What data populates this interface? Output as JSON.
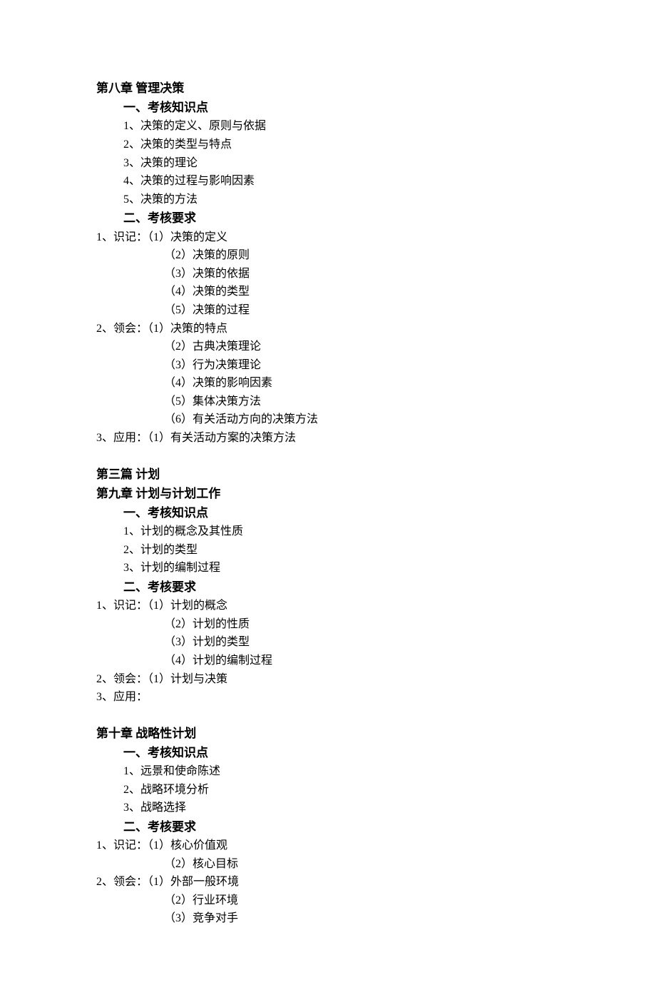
{
  "ch8": {
    "title": "第八章 管理决策",
    "s1": {
      "heading": "一、考核知识点",
      "p1": "1、决策的定义、原则与依据",
      "p2": "2、决策的类型与特点",
      "p3": "3、决策的理论",
      "p4": "4、决策的过程与影响因素",
      "p5": "5、决策的方法"
    },
    "s2": {
      "heading": "二、考核要求",
      "r1": "1、识记：（1）决策的定义",
      "r1a": "（2）决策的原则",
      "r1b": "（3）决策的依据",
      "r1c": "（4）决策的类型",
      "r1d": "（5）决策的过程",
      "r2": "2、领会：（1）决策的特点",
      "r2a": "（2）古典决策理论",
      "r2b": "（3）行为决策理论",
      "r2c": "（4）决策的影响因素",
      "r2d": "（5）集体决策方法",
      "r2e": "（6）有关活动方向的决策方法",
      "r3": "3、应用：（1）有关活动方案的决策方法"
    }
  },
  "part3": {
    "title": "第三篇 计划"
  },
  "ch9": {
    "title": "第九章 计划与计划工作",
    "s1": {
      "heading": "一、考核知识点",
      "p1": "1、计划的概念及其性质",
      "p2": "2、计划的类型",
      "p3": "3、计划的编制过程"
    },
    "s2": {
      "heading": "二、考核要求",
      "r1": "1、识记：（1）计划的概念",
      "r1a": "（2）计划的性质",
      "r1b": "（3）计划的类型",
      "r1c": "（4）计划的编制过程",
      "r2": "2、领会：（1）计划与决策",
      "r3": "3、应用："
    }
  },
  "ch10": {
    "title": "第十章 战略性计划",
    "s1": {
      "heading": "一、考核知识点",
      "p1": "1、远景和使命陈述",
      "p2": "2、战略环境分析",
      "p3": "3、战略选择"
    },
    "s2": {
      "heading": "二、考核要求",
      "r1": "1、识记：（1）核心价值观",
      "r1a": "（2）核心目标",
      "r2": "2、领会：（1）外部一般环境",
      "r2a": "（2）行业环境",
      "r2b": "（3）竞争对手"
    }
  }
}
